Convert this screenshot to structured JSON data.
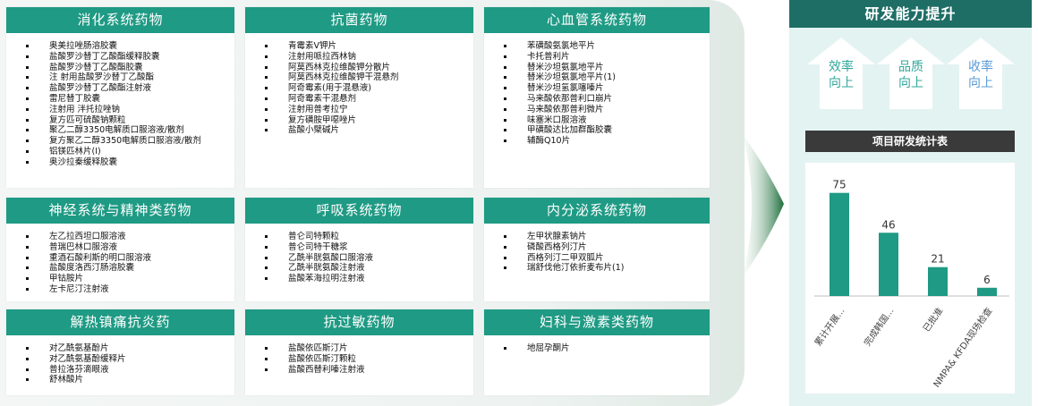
{
  "categories": [
    {
      "title": "消化系统药物",
      "items": [
        "奥美拉唑肠溶胶囊",
        "盐酸罗沙替丁乙酸酯缓释胶囊",
        "盐酸罗沙替丁乙酸酯胶囊",
        "注 射用盐酸罗沙替丁乙酸酯",
        "盐酸罗沙替丁乙酸酯注射液",
        "雷尼替丁胶囊",
        "注射用 泮托拉唑钠",
        "复方匹可硫酸钠颗粒",
        "聚乙二醇3350电解质口服溶液/散剂",
        "复方聚乙二醇3350电解质口服溶液/散剂",
        "铝镁匹林片(I)",
        "奥沙拉秦缓释胶囊"
      ]
    },
    {
      "title": "抗菌药物",
      "items": [
        "青霉素V钾片",
        "注射用哌拉西林钠",
        "阿莫西林克拉维酸钾分散片",
        "阿莫西林克拉维酸钾干混悬剂",
        "阿奇霉素(用于混悬液)",
        "阿奇霉素干混悬剂",
        "注射用普考拉宁",
        "复方磺胺甲噁唑片",
        "盐酸小檗碱片"
      ]
    },
    {
      "title": "心血管系统药物",
      "items": [
        "苯磺酸氨氯地平片",
        "卡托普利片",
        "替米沙坦氨氯地平片",
        "替米沙坦氨氯地平片(1)",
        "替米沙坦氢氯噻嗪片",
        "马来酸依那普利口崩片",
        "马来酸依那普利微片",
        "味塞米口服溶液",
        "甲磺酸达比加群酯胶囊",
        "辅酶Q10片"
      ]
    },
    {
      "title": "神经系统与精神类药物",
      "items": [
        "左乙拉西坦口服溶液",
        "普瑞巴林口服溶液",
        "重酒石酸利斯的明口服溶液",
        "盐酸度洛西汀肠溶胶囊",
        "甲钴胺片",
        "左卡尼汀注射液"
      ]
    },
    {
      "title": "呼吸系统药物",
      "items": [
        "普仑司特颗粒",
        "普仑司特干糖浆",
        "乙酰半胱氨酸口服溶液",
        "乙酰半胱氨酸注射液",
        "盐酸苯海拉明注射液"
      ]
    },
    {
      "title": "内分泌系统药物",
      "items": [
        "左甲状腺素钠片",
        "磷酸西格列汀片",
        "西格列汀二甲双胍片",
        "瑞舒伐他汀依折麦布片(1)"
      ]
    },
    {
      "title": "解热镇痛抗炎药",
      "items": [
        "对乙酰氨基酚片",
        "对乙酰氨基酚缓释片",
        "普拉洛芬滴眼液",
        "舒林酸片"
      ]
    },
    {
      "title": "抗过敏药物",
      "items": [
        "盐酸依匹斯汀片",
        "盐酸依匹斯汀颗粒",
        "盐酸西替利嗪注射液"
      ]
    },
    {
      "title": "妇科与激素类药物",
      "items": [
        "地屈孕酮片"
      ]
    }
  ],
  "rd": {
    "title": "研发能力提升",
    "arrows": [
      {
        "line1": "效率",
        "line2": "向上",
        "color": "#2fa79a"
      },
      {
        "line1": "品质",
        "line2": "向上",
        "color": "#2fa79a"
      },
      {
        "line1": "收率",
        "line2": "向上",
        "color": "#5b9bd5"
      }
    ],
    "stats_title": "项目研发统计表"
  },
  "chart_data": {
    "type": "bar",
    "categories": [
      "累计开展...",
      "完成韩国...",
      "已批准",
      "NMPA& KFDA现场检查"
    ],
    "values": [
      75,
      46,
      21,
      6
    ],
    "ylim": [
      0,
      80
    ],
    "color": "#1f9a84",
    "title": "项目研发统计表"
  }
}
